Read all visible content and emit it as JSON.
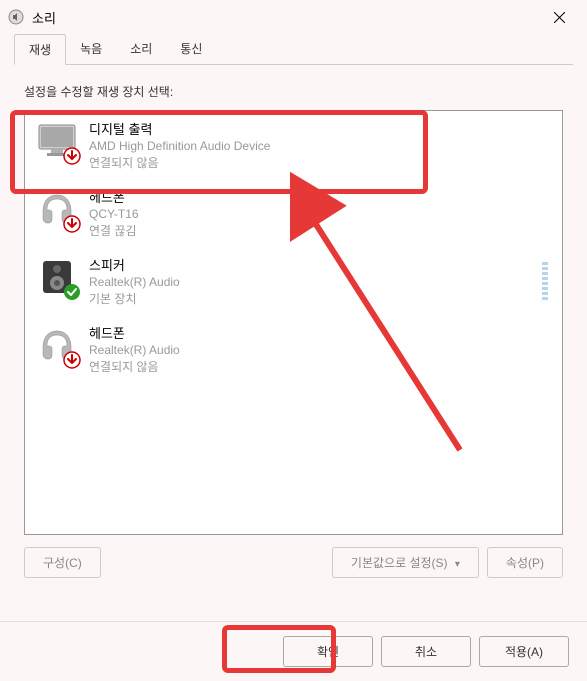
{
  "titlebar": {
    "title": "소리"
  },
  "tabs": [
    {
      "label": "재생",
      "active": true
    },
    {
      "label": "녹음",
      "active": false
    },
    {
      "label": "소리",
      "active": false
    },
    {
      "label": "통신",
      "active": false
    }
  ],
  "instruction": "설정을 수정할 재생 장치 선택:",
  "devices": [
    {
      "title": "디지털 출력",
      "subtitle": "AMD High Definition Audio Device",
      "status": "연결되지 않음",
      "icon": "monitor",
      "badge": "down-red"
    },
    {
      "title": "헤드폰",
      "subtitle": "QCY-T16",
      "status": "연결 끊김",
      "icon": "headphones",
      "badge": "down-red"
    },
    {
      "title": "스피커",
      "subtitle": "Realtek(R) Audio",
      "status": "기본 장치",
      "icon": "speaker",
      "badge": "check-green",
      "meter": true
    },
    {
      "title": "헤드폰",
      "subtitle": "Realtek(R) Audio",
      "status": "연결되지 않음",
      "icon": "headphones",
      "badge": "down-red"
    }
  ],
  "buttons": {
    "configure": "구성(C)",
    "set_default": "기본값으로 설정(S)",
    "properties": "속성(P)"
  },
  "dialog_buttons": {
    "ok": "확인",
    "cancel": "취소",
    "apply": "적용(A)"
  }
}
